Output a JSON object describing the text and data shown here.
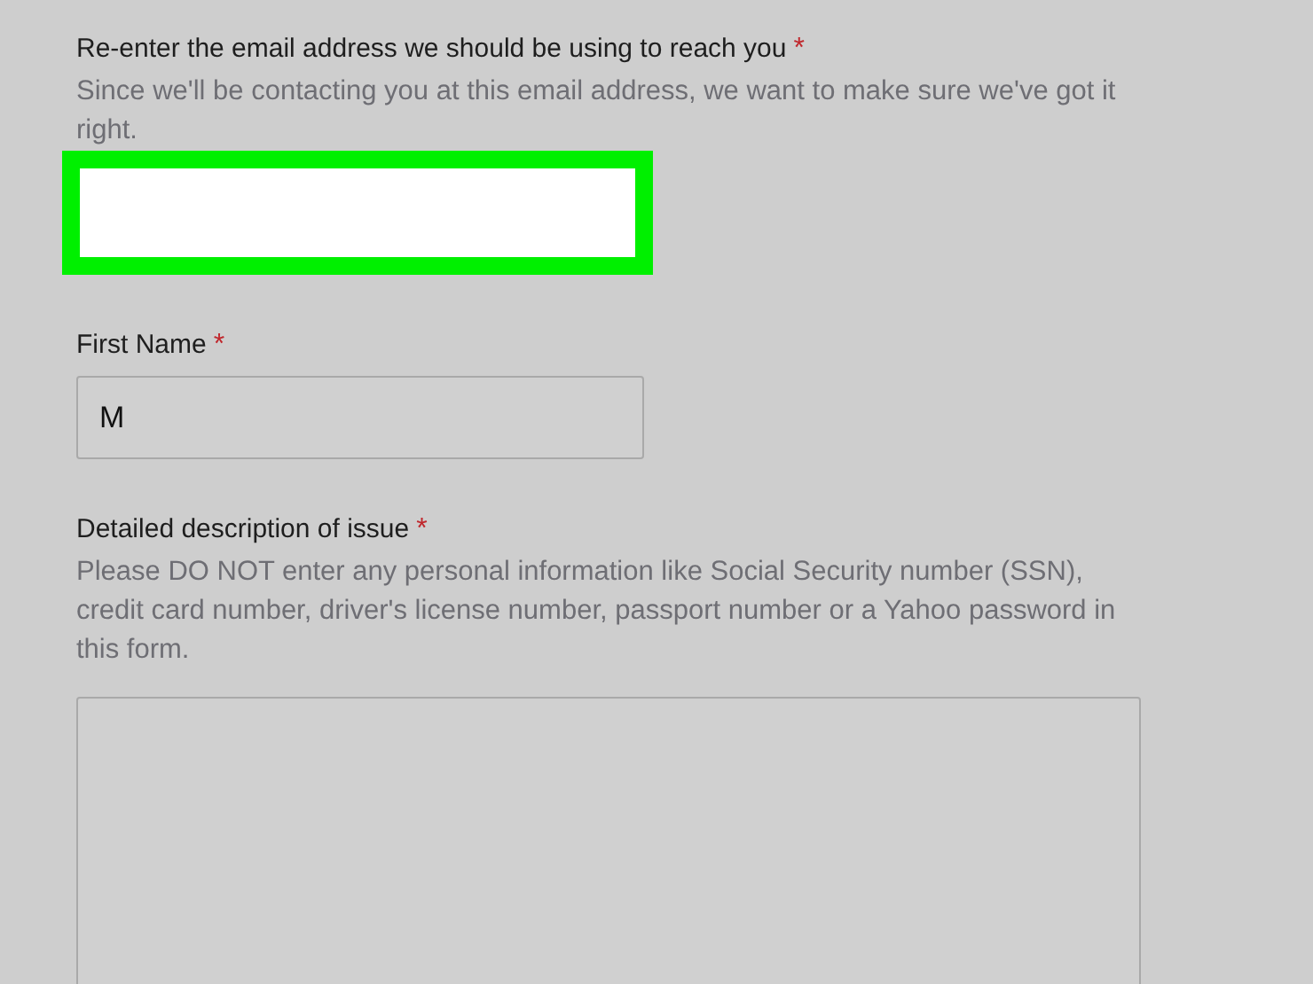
{
  "fields": [
    {
      "kind": "input",
      "label": "Re-enter the email address we should be using to reach you",
      "required_mark": "*",
      "help": "Since we'll be contacting you at this email address, we want to make sure we've got it right.",
      "highlighted": true
    },
    {
      "kind": "input",
      "label": "First Name",
      "required_mark": "*",
      "value": "M",
      "highlighted": false
    },
    {
      "kind": "textarea",
      "label": "Detailed description of issue",
      "required_mark": "*",
      "help": "Please DO NOT enter any personal information like Social Security number (SSN), credit card number, driver's license number, passport number or a Yahoo password in this form.",
      "highlighted": false
    }
  ]
}
